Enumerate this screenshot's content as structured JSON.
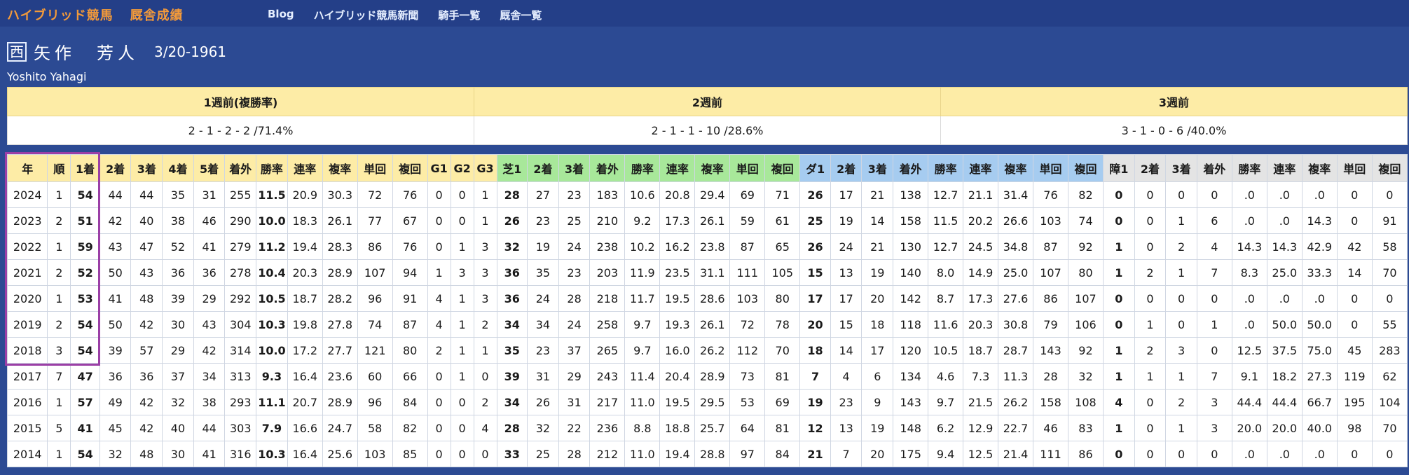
{
  "nav": {
    "brand": "ハイブリッド競馬",
    "section": "厩舎成績",
    "links": [
      "Blog",
      "ハイブリッド競馬新聞",
      "騎手一覧",
      "厩舎一覧"
    ]
  },
  "jockey": {
    "region": "西",
    "name": "矢作　芳人",
    "dob": "3/20-1961",
    "name_en": "Yoshito Yahagi"
  },
  "weeks": {
    "headers": [
      "1週前(複勝率)",
      "2週前",
      "3週前"
    ],
    "values": [
      "2 - 1 - 2 - 2 /71.4%",
      "2 - 1 - 1 - 10 /28.6%",
      "3 - 1 - 0 - 6 /40.0%"
    ]
  },
  "stats": {
    "headers": [
      "年",
      "順",
      "1着",
      "2着",
      "3着",
      "4着",
      "5着",
      "着外",
      "勝率",
      "連率",
      "複率",
      "単回",
      "複回",
      "G1",
      "G2",
      "G3",
      "芝1",
      "2着",
      "3着",
      "着外",
      "勝率",
      "連率",
      "複率",
      "単回",
      "複回",
      "ダ1",
      "2着",
      "3着",
      "着外",
      "勝率",
      "連率",
      "複率",
      "単回",
      "複回",
      "障1",
      "2着",
      "3着",
      "着外",
      "勝率",
      "連率",
      "複率",
      "単回",
      "複回"
    ],
    "rows": [
      [
        "2024",
        "1",
        "54",
        "44",
        "44",
        "35",
        "31",
        "255",
        "11.5",
        "20.9",
        "30.3",
        "72",
        "76",
        "0",
        "0",
        "1",
        "28",
        "27",
        "23",
        "183",
        "10.6",
        "20.8",
        "29.4",
        "69",
        "71",
        "26",
        "17",
        "21",
        "138",
        "12.7",
        "21.1",
        "31.4",
        "76",
        "82",
        "0",
        "0",
        "0",
        "0",
        ".0",
        ".0",
        ".0",
        "0",
        "0"
      ],
      [
        "2023",
        "2",
        "51",
        "42",
        "40",
        "38",
        "46",
        "290",
        "10.0",
        "18.3",
        "26.1",
        "77",
        "67",
        "0",
        "0",
        "1",
        "26",
        "23",
        "25",
        "210",
        "9.2",
        "17.3",
        "26.1",
        "59",
        "61",
        "25",
        "19",
        "14",
        "158",
        "11.5",
        "20.2",
        "26.6",
        "103",
        "74",
        "0",
        "0",
        "1",
        "6",
        ".0",
        ".0",
        "14.3",
        "0",
        "91"
      ],
      [
        "2022",
        "1",
        "59",
        "43",
        "47",
        "52",
        "41",
        "279",
        "11.2",
        "19.4",
        "28.3",
        "86",
        "76",
        "0",
        "1",
        "3",
        "32",
        "19",
        "24",
        "238",
        "10.2",
        "16.2",
        "23.8",
        "87",
        "65",
        "26",
        "24",
        "21",
        "130",
        "12.7",
        "24.5",
        "34.8",
        "87",
        "92",
        "1",
        "0",
        "2",
        "4",
        "14.3",
        "14.3",
        "42.9",
        "42",
        "58"
      ],
      [
        "2021",
        "2",
        "52",
        "50",
        "43",
        "36",
        "36",
        "278",
        "10.4",
        "20.3",
        "28.9",
        "107",
        "94",
        "1",
        "3",
        "3",
        "36",
        "35",
        "23",
        "203",
        "11.9",
        "23.5",
        "31.1",
        "111",
        "105",
        "15",
        "13",
        "19",
        "140",
        "8.0",
        "14.9",
        "25.0",
        "107",
        "80",
        "1",
        "2",
        "1",
        "7",
        "8.3",
        "25.0",
        "33.3",
        "14",
        "70"
      ],
      [
        "2020",
        "1",
        "53",
        "41",
        "48",
        "39",
        "29",
        "292",
        "10.5",
        "18.7",
        "28.2",
        "96",
        "91",
        "4",
        "1",
        "3",
        "36",
        "24",
        "28",
        "218",
        "11.7",
        "19.5",
        "28.6",
        "103",
        "80",
        "17",
        "17",
        "20",
        "142",
        "8.7",
        "17.3",
        "27.6",
        "86",
        "107",
        "0",
        "0",
        "0",
        "0",
        ".0",
        ".0",
        ".0",
        "0",
        "0"
      ],
      [
        "2019",
        "2",
        "54",
        "50",
        "42",
        "30",
        "43",
        "304",
        "10.3",
        "19.8",
        "27.8",
        "74",
        "87",
        "4",
        "1",
        "2",
        "34",
        "34",
        "24",
        "258",
        "9.7",
        "19.3",
        "26.1",
        "72",
        "78",
        "20",
        "15",
        "18",
        "118",
        "11.6",
        "20.3",
        "30.8",
        "79",
        "106",
        "0",
        "1",
        "0",
        "1",
        ".0",
        "50.0",
        "50.0",
        "0",
        "55"
      ],
      [
        "2018",
        "3",
        "54",
        "39",
        "57",
        "29",
        "42",
        "314",
        "10.0",
        "17.2",
        "27.7",
        "121",
        "80",
        "2",
        "1",
        "1",
        "35",
        "23",
        "37",
        "265",
        "9.7",
        "16.0",
        "26.2",
        "112",
        "70",
        "18",
        "14",
        "17",
        "120",
        "10.5",
        "18.7",
        "28.7",
        "143",
        "92",
        "1",
        "2",
        "3",
        "0",
        "12.5",
        "37.5",
        "75.0",
        "45",
        "283"
      ],
      [
        "2017",
        "7",
        "47",
        "36",
        "36",
        "37",
        "34",
        "313",
        "9.3",
        "16.4",
        "23.6",
        "60",
        "66",
        "0",
        "1",
        "0",
        "39",
        "31",
        "29",
        "243",
        "11.4",
        "20.4",
        "28.9",
        "73",
        "81",
        "7",
        "4",
        "6",
        "134",
        "4.6",
        "7.3",
        "11.3",
        "28",
        "32",
        "1",
        "1",
        "1",
        "7",
        "9.1",
        "18.2",
        "27.3",
        "119",
        "62"
      ],
      [
        "2016",
        "1",
        "57",
        "49",
        "42",
        "32",
        "38",
        "293",
        "11.1",
        "20.7",
        "28.9",
        "96",
        "84",
        "0",
        "0",
        "2",
        "34",
        "26",
        "31",
        "217",
        "11.0",
        "19.5",
        "29.5",
        "53",
        "69",
        "19",
        "23",
        "9",
        "143",
        "9.7",
        "21.5",
        "26.2",
        "158",
        "108",
        "4",
        "0",
        "2",
        "3",
        "44.4",
        "44.4",
        "66.7",
        "195",
        "104"
      ],
      [
        "2015",
        "5",
        "41",
        "45",
        "42",
        "40",
        "44",
        "303",
        "7.9",
        "16.6",
        "24.7",
        "58",
        "82",
        "0",
        "0",
        "4",
        "28",
        "32",
        "22",
        "236",
        "8.8",
        "18.8",
        "25.7",
        "64",
        "81",
        "12",
        "13",
        "19",
        "148",
        "6.2",
        "12.9",
        "22.7",
        "46",
        "83",
        "1",
        "0",
        "1",
        "3",
        "20.0",
        "20.0",
        "40.0",
        "98",
        "70"
      ],
      [
        "2014",
        "1",
        "54",
        "32",
        "48",
        "30",
        "41",
        "316",
        "10.3",
        "16.4",
        "25.6",
        "103",
        "85",
        "0",
        "0",
        "0",
        "33",
        "25",
        "28",
        "212",
        "11.0",
        "19.4",
        "28.8",
        "97",
        "84",
        "21",
        "7",
        "20",
        "175",
        "9.4",
        "12.5",
        "21.4",
        "111",
        "86",
        "0",
        "0",
        "0",
        "0",
        ".0",
        ".0",
        ".0",
        "0",
        "0"
      ]
    ]
  }
}
